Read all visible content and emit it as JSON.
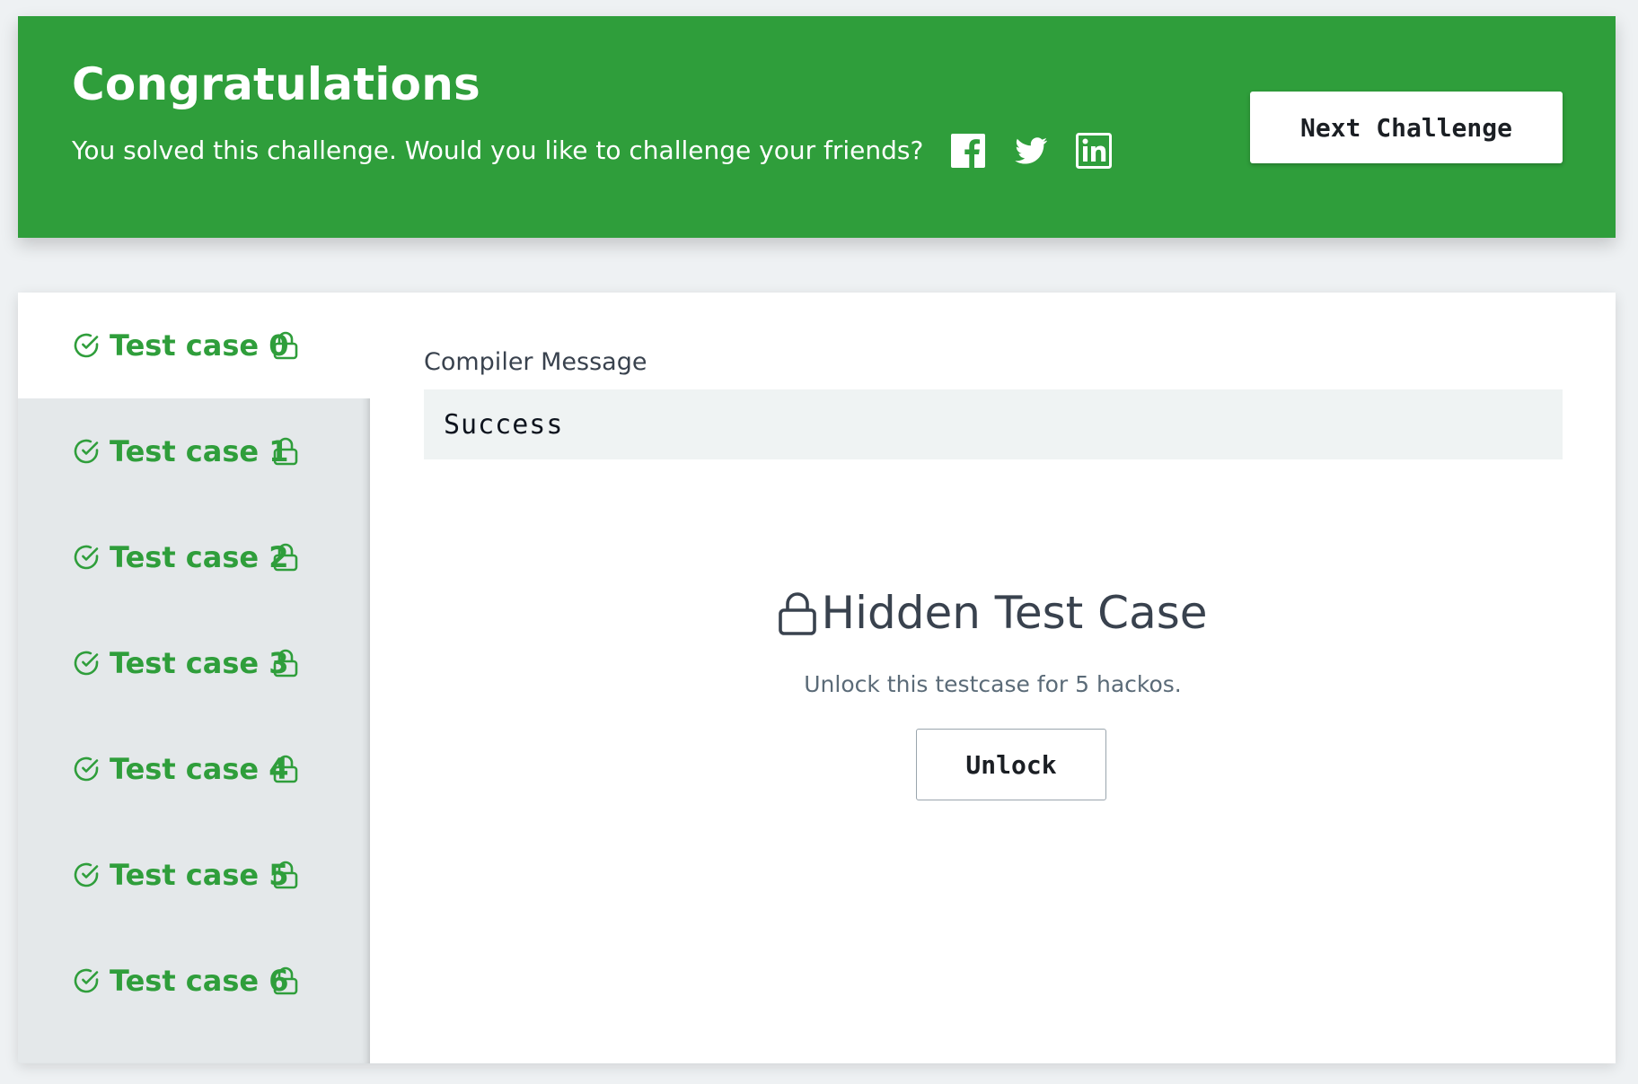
{
  "banner": {
    "title": "Congratulations",
    "subtitle": "You solved this challenge. Would you like to challenge your friends?",
    "share_icons": [
      "facebook-icon",
      "twitter-icon",
      "linkedin-icon"
    ],
    "next_button_label": "Next Challenge",
    "background_color": "#2f9e3b"
  },
  "tabs": [
    {
      "label": "Test case 0",
      "status_icon": "check-circle-icon",
      "locked_icon": "lock-icon",
      "active": true
    },
    {
      "label": "Test case 1",
      "status_icon": "check-circle-icon",
      "locked_icon": "lock-icon",
      "active": false
    },
    {
      "label": "Test case 2",
      "status_icon": "check-circle-icon",
      "locked_icon": "lock-icon",
      "active": false
    },
    {
      "label": "Test case 3",
      "status_icon": "check-circle-icon",
      "locked_icon": "lock-icon",
      "active": false
    },
    {
      "label": "Test case 4",
      "status_icon": "check-circle-icon",
      "locked_icon": "lock-icon",
      "active": false
    },
    {
      "label": "Test case 5",
      "status_icon": "check-circle-icon",
      "locked_icon": "lock-icon",
      "active": false
    },
    {
      "label": "Test case 6",
      "status_icon": "check-circle-icon",
      "locked_icon": "lock-icon",
      "active": false
    }
  ],
  "compiler": {
    "label": "Compiler Message",
    "value": "Success"
  },
  "hidden_case": {
    "title": "Hidden Test Case",
    "note": "Unlock this testcase for 5 hackos.",
    "unlock_label": "Unlock"
  },
  "colors": {
    "success_green": "#2f9e3b",
    "tab_background": "#e4e8ea",
    "text_dark": "#39424e"
  }
}
